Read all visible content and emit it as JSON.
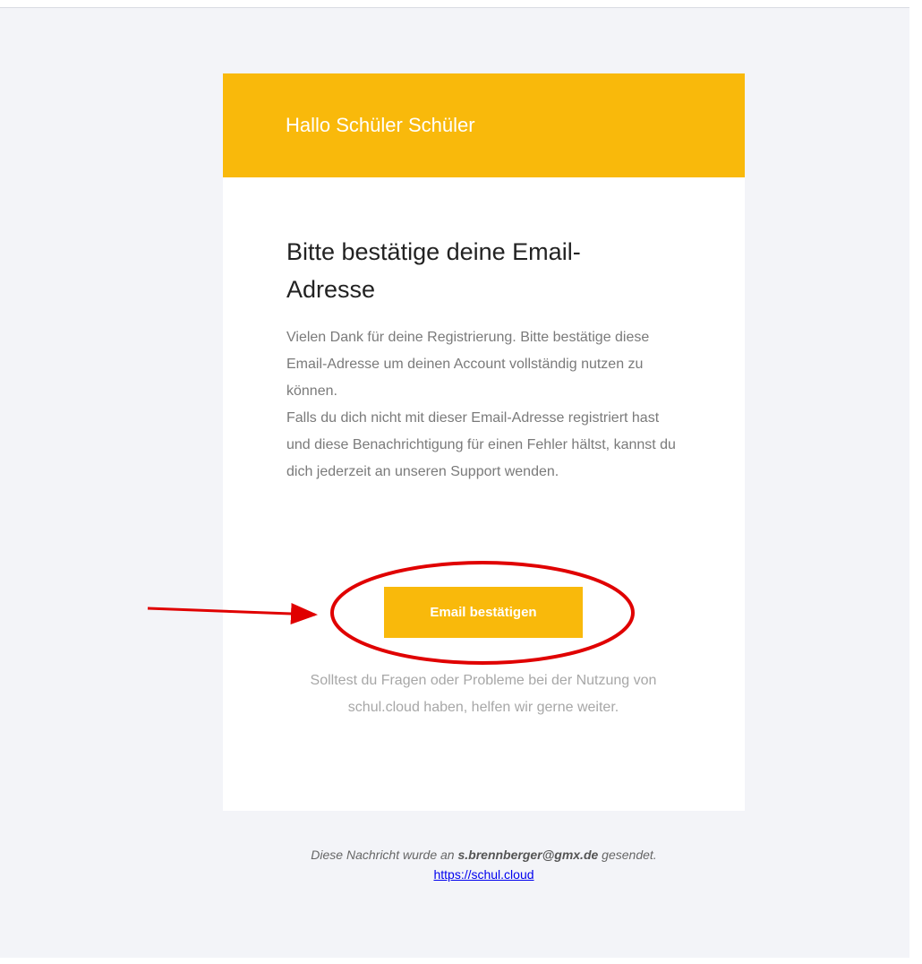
{
  "email": {
    "greeting": "Hallo Schüler Schüler",
    "heading": "Bitte bestätige deine Email-Adresse",
    "body_line_1": "Vielen Dank für deine Registrierung. Bitte bestätige diese Email-Adresse um deinen Account vollständig nutzen zu können.",
    "body_line_2": "Falls du dich nicht mit dieser Email-Adresse registriert hast und diese Benachrichtigung für einen Fehler hältst, kannst du dich jederzeit an unseren Support wenden.",
    "confirm_button_label": "Email bestätigen",
    "help_text": "Solltest du Fragen oder Probleme bei der Nutzung von schul.cloud haben, helfen wir gerne weiter."
  },
  "footer": {
    "note_prefix": "Diese Nachricht wurde an ",
    "recipient": "s.brennberger@gmx.de",
    "note_suffix": " gesendet.",
    "link_text": "https://schul.cloud"
  },
  "colors": {
    "accent": "#f9b90b",
    "annotation": "#e00000",
    "background": "#f3f4f8"
  }
}
